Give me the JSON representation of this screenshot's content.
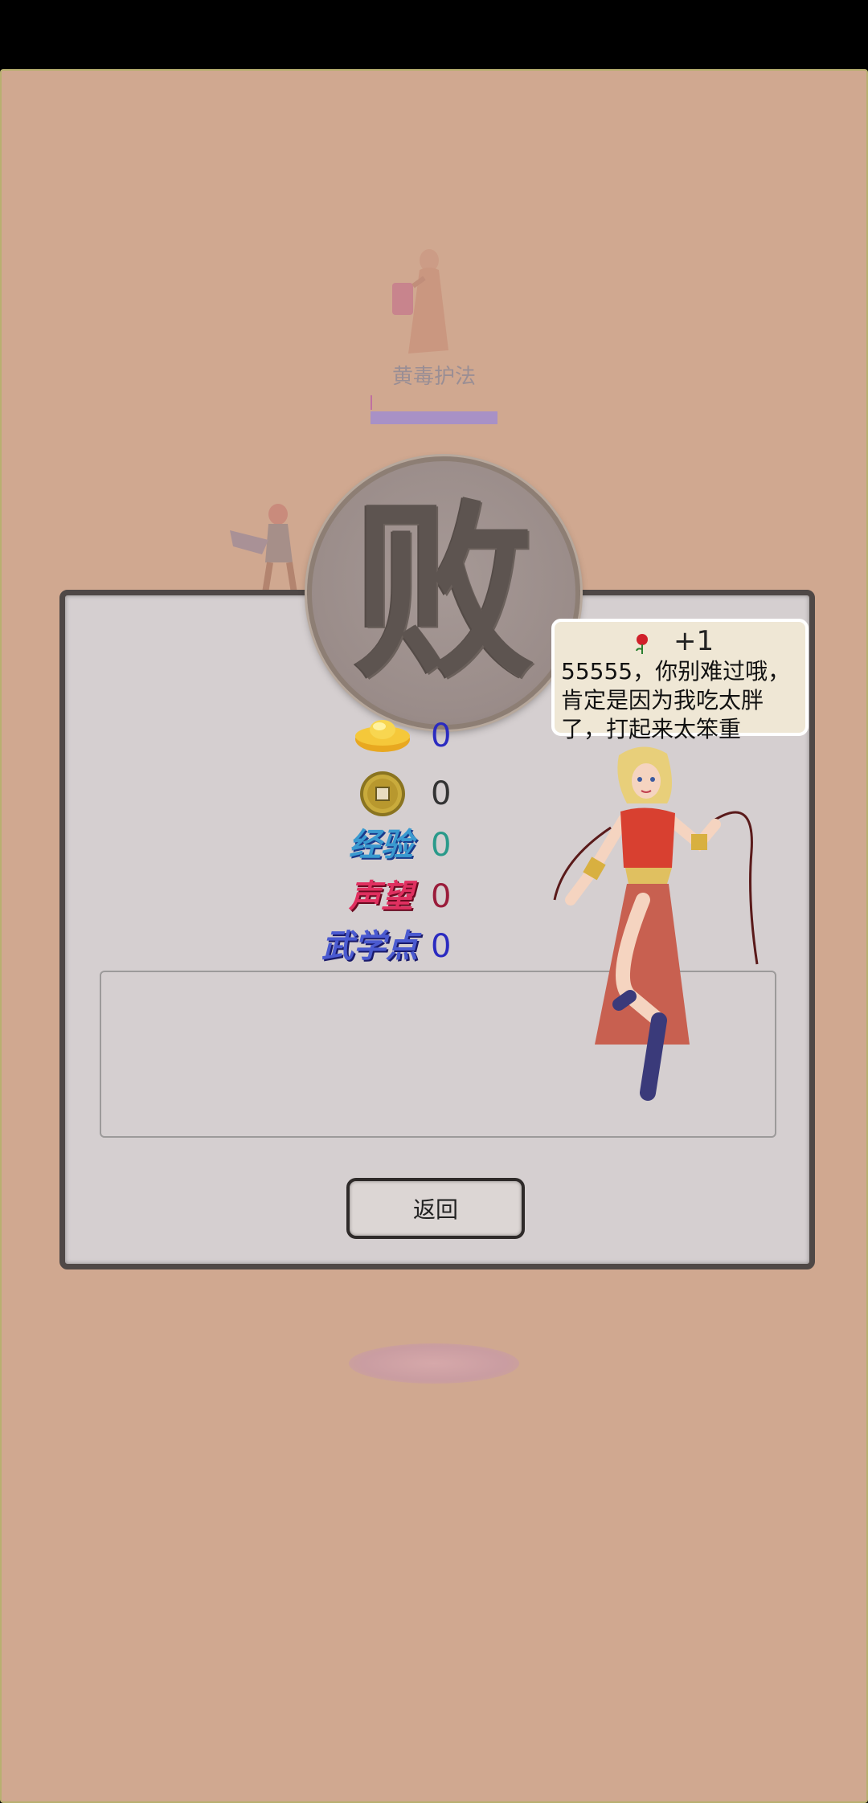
{
  "enemy": {
    "name": "黄毒护法",
    "hp_fraction": 1.0
  },
  "result": {
    "stamp_char": "败"
  },
  "rewards": {
    "gold_ingot": "0",
    "copper_coin": "0",
    "experience": {
      "label": "经验",
      "value": "0"
    },
    "reputation": {
      "label": "声望",
      "value": "0"
    },
    "martial_points": {
      "label": "武学点",
      "value": "0"
    }
  },
  "speech": {
    "gain": "+1",
    "text": "55555，你别难过哦，肯定是因为我吃太胖了，打起来太笨重"
  },
  "buttons": {
    "back": "返回"
  },
  "colors": {
    "background": "#d0a890",
    "panel": "#d5cfd0",
    "gold_value": "#2b2bc0",
    "coin_value": "#333333",
    "exp_value": "#2a9a8a",
    "rep_value": "#9a1c3a",
    "martial_value": "#2b2bc0"
  },
  "icons": {
    "gold_ingot": "gold-ingot-icon",
    "copper_coin": "copper-coin-icon",
    "rose": "rose-icon"
  }
}
